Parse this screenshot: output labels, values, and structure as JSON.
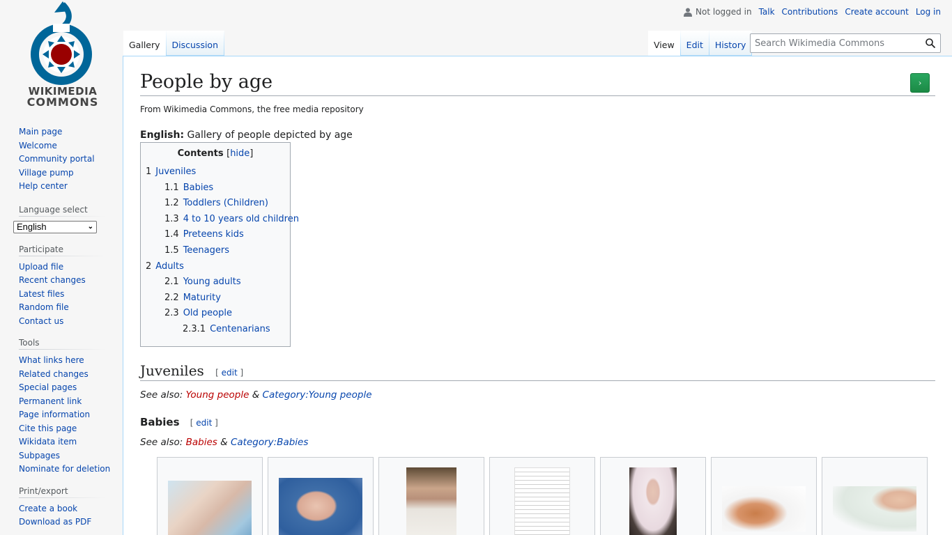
{
  "logo": {
    "line1": "WIKIMEDIA",
    "line2": "COMMONS",
    "colors": {
      "blue": "#006699",
      "red": "#990000"
    }
  },
  "personal": {
    "not_logged_in": "Not logged in",
    "talk": "Talk",
    "contributions": "Contributions",
    "create_account": "Create account",
    "log_in": "Log in"
  },
  "tabs": {
    "gallery": "Gallery",
    "discussion": "Discussion",
    "view": "View",
    "edit": "Edit",
    "history": "History"
  },
  "search": {
    "placeholder": "Search Wikimedia Commons"
  },
  "sidebar": {
    "nav": [
      "Main page",
      "Welcome",
      "Community portal",
      "Village pump",
      "Help center"
    ],
    "language_heading": "Language select",
    "language_value": "English",
    "participate_heading": "Participate",
    "participate": [
      "Upload file",
      "Recent changes",
      "Latest files",
      "Random file",
      "Contact us"
    ],
    "tools_heading": "Tools",
    "tools": [
      "What links here",
      "Related changes",
      "Special pages",
      "Permanent link",
      "Page information",
      "Cite this page",
      "Wikidata item",
      "Subpages",
      "Nominate for deletion"
    ],
    "print_heading": "Print/export",
    "print": [
      "Create a book",
      "Download as PDF"
    ]
  },
  "page": {
    "title": "People by age",
    "site_sub": "From Wikimedia Commons, the free media repository",
    "lang_label": "English:",
    "lang_text": " Gallery of people depicted by age",
    "go_glyph": "›"
  },
  "toc": {
    "title": "Contents",
    "hide": "hide",
    "items": [
      {
        "num": "1",
        "label": "Juveniles",
        "level": 1
      },
      {
        "num": "1.1",
        "label": "Babies",
        "level": 2
      },
      {
        "num": "1.2",
        "label": "Toddlers (Children)",
        "level": 2
      },
      {
        "num": "1.3",
        "label": "4 to 10 years old children",
        "level": 2
      },
      {
        "num": "1.4",
        "label": "Preteens kids",
        "level": 2
      },
      {
        "num": "1.5",
        "label": "Teenagers",
        "level": 2
      },
      {
        "num": "2",
        "label": "Adults",
        "level": 1
      },
      {
        "num": "2.1",
        "label": "Young adults",
        "level": 2
      },
      {
        "num": "2.2",
        "label": "Maturity",
        "level": 2
      },
      {
        "num": "2.3",
        "label": "Old people",
        "level": 2
      },
      {
        "num": "2.3.1",
        "label": "Centenarians",
        "level": 3
      }
    ]
  },
  "sections": {
    "juveniles": {
      "heading": "Juveniles",
      "edit": "edit",
      "see_also": "See also: ",
      "link1": "Young people",
      "amp": " & ",
      "link2": "Category:Young people"
    },
    "babies": {
      "heading": "Babies",
      "edit": "edit",
      "see_also": "See also: ",
      "link1": "Babies",
      "amp": " & ",
      "link2": "Category:Babies"
    }
  }
}
